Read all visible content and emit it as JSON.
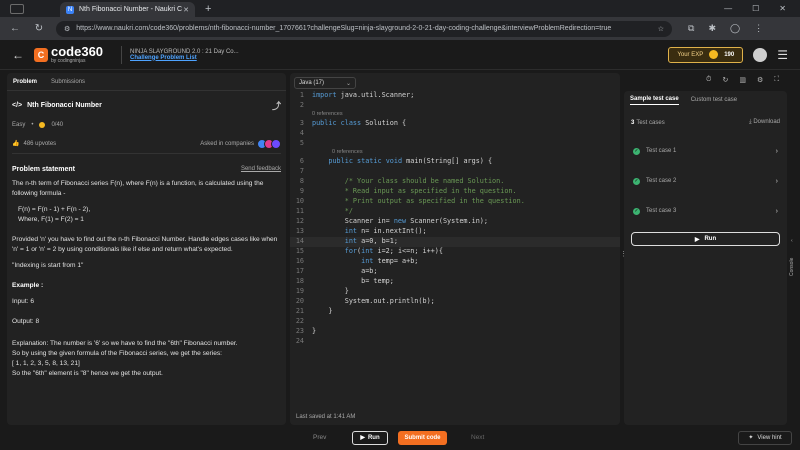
{
  "browser": {
    "tab_title": "Nth Fibonacci Number - Naukri C",
    "url": "https://www.naukri.com/code360/problems/nth-fibonacci-number_1707661?challengeSlug=ninja-slayground-2-0-21-day-coding-challenge&interviewProblemRedirection=true"
  },
  "header": {
    "logo_text": "code360",
    "logo_sub": "by codingninjas",
    "challenge_title": "NINJA SLAYGROUND 2.0 : 21 Day Co...",
    "challenge_link": "Challenge Problem List",
    "exp_label": "Your EXP",
    "exp_value": "190"
  },
  "left_panel": {
    "tabs": [
      "Problem",
      "Submissions"
    ],
    "title": "Nth Fibonacci Number",
    "difficulty": "Easy",
    "score": "0/40",
    "upvotes": "486 upvotes",
    "asked_in": "Asked in companies",
    "statement_heading": "Problem statement",
    "send_feedback": "Send feedback",
    "p1": "The n-th term of Fibonacci series F(n), where F(n) is a function, is calculated using the following formula -",
    "f1": "F(n) = F(n - 1) + F(n - 2),",
    "f2": "Where, F(1) = F(2) = 1",
    "p2": "Provided 'n' you have to find out the n-th Fibonacci Number. Handle edges cases like when 'n' = 1 or 'n' = 2 by using conditionals like if else and return what's expected.",
    "p3": "\"Indexing is start from 1\"",
    "example_heading": "Example :",
    "input": "Input: 6",
    "output": "Output: 8",
    "explanation": "Explanation: The number is '6' so we have to find the \"6th\" Fibonacci number.",
    "explanation2": "So by using the given formula of the Fibonacci series, we get the series:",
    "series": "[ 1, 1, 2, 3, 5, 8, 13, 21]",
    "conclusion": "So the \"6th\" element is \"8\" hence we get the output."
  },
  "editor": {
    "language": "Java (17)",
    "references": "0 references",
    "last_saved": "Last saved at 1:41 AM",
    "lines": [
      {
        "n": "1",
        "t": "import java.util.Scanner;"
      },
      {
        "n": "2",
        "t": ""
      },
      {
        "n": "3",
        "t": "public class Solution {"
      },
      {
        "n": "4",
        "t": ""
      },
      {
        "n": "5",
        "t": ""
      },
      {
        "n": "6",
        "t": "    public static void main(String[] args) {"
      },
      {
        "n": "7",
        "t": ""
      },
      {
        "n": "8",
        "t": "        /* Your class should be named Solution."
      },
      {
        "n": "9",
        "t": "        * Read input as specified in the question."
      },
      {
        "n": "10",
        "t": "        * Print output as specified in the question."
      },
      {
        "n": "11",
        "t": "        */"
      },
      {
        "n": "12",
        "t": "        Scanner in= new Scanner(System.in);"
      },
      {
        "n": "13",
        "t": "        int n= in.nextInt();"
      },
      {
        "n": "14",
        "t": "        int a=0, b=1;"
      },
      {
        "n": "15",
        "t": "        for(int i=2; i<=n; i++){"
      },
      {
        "n": "16",
        "t": "            int temp= a+b;"
      },
      {
        "n": "17",
        "t": "            a=b;"
      },
      {
        "n": "18",
        "t": "            b= temp;"
      },
      {
        "n": "19",
        "t": "        }"
      },
      {
        "n": "20",
        "t": "        System.out.println(b);"
      },
      {
        "n": "21",
        "t": "    }"
      },
      {
        "n": "22",
        "t": ""
      },
      {
        "n": "23",
        "t": "}"
      },
      {
        "n": "24",
        "t": ""
      }
    ]
  },
  "right_panel": {
    "tabs": [
      "Sample test case",
      "Custom test case"
    ],
    "test_count": "3",
    "test_label": "Test cases",
    "download": "Download",
    "cases": [
      "Test case 1",
      "Test case 2",
      "Test case 3"
    ],
    "run": "Run",
    "console": "Console"
  },
  "bottom": {
    "prev": "Prev",
    "run": "Run",
    "submit": "Submit code",
    "next": "Next",
    "hint": "View hint"
  }
}
